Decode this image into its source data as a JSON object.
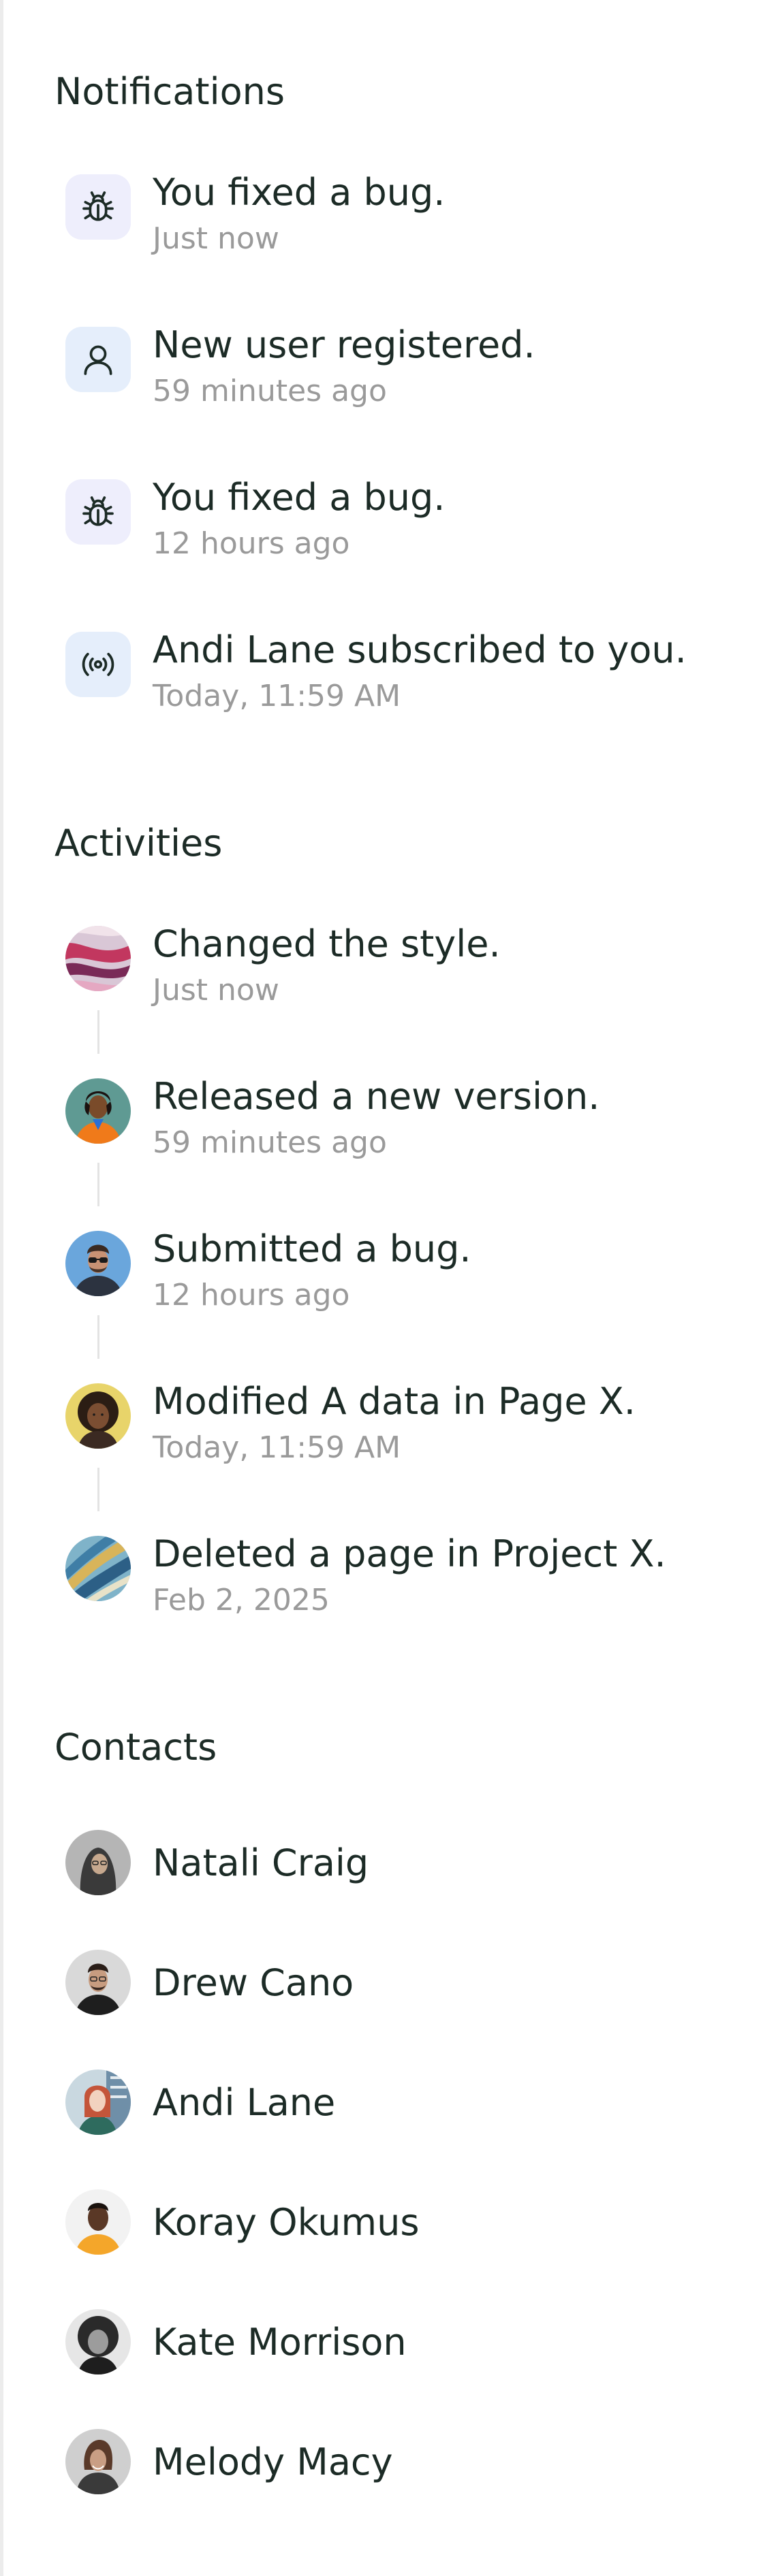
{
  "notifications": {
    "title": "Notifications",
    "items": [
      {
        "icon": "bug-icon",
        "text": "You fixed a bug.",
        "time": "Just now",
        "bg": "#eeeefc"
      },
      {
        "icon": "user-icon",
        "text": "New user registered.",
        "time": "59 minutes ago",
        "bg": "#e5eefb"
      },
      {
        "icon": "bug-icon",
        "text": "You fixed a bug.",
        "time": "12 hours ago",
        "bg": "#eeeefc"
      },
      {
        "icon": "broadcast-icon",
        "text": "Andi Lane subscribed to you.",
        "time": "Today, 11:59 AM",
        "bg": "#e5eefb"
      }
    ]
  },
  "activities": {
    "title": "Activities",
    "items": [
      {
        "text": "Changed the style.",
        "time": "Just now"
      },
      {
        "text": "Released a new version.",
        "time": "59 minutes ago"
      },
      {
        "text": "Submitted a bug.",
        "time": "12 hours ago"
      },
      {
        "text": "Modified A data in Page X.",
        "time": "Today, 11:59 AM"
      },
      {
        "text": "Deleted a page in Project X.",
        "time": "Feb 2, 2025"
      }
    ]
  },
  "contacts": {
    "title": "Contacts",
    "items": [
      {
        "name": "Natali Craig"
      },
      {
        "name": "Drew Cano"
      },
      {
        "name": "Andi Lane"
      },
      {
        "name": "Koray Okumus"
      },
      {
        "name": "Kate Morrison"
      },
      {
        "name": "Melody Macy"
      }
    ]
  },
  "colors": {
    "text": "#1c2b26",
    "muted": "#9a9a9a",
    "icon_bg_purple": "#eeeefc",
    "icon_bg_blue": "#e5eefb",
    "divider": "#e3e3e3"
  }
}
